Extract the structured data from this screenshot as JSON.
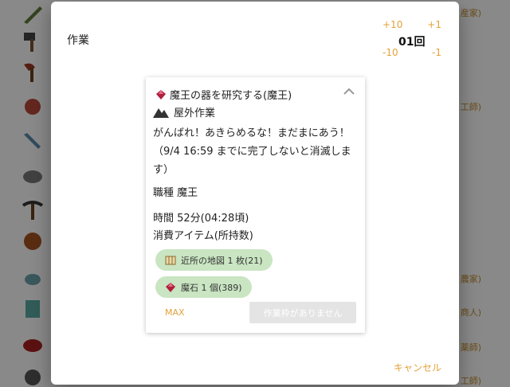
{
  "background": {
    "right_labels": [
      "産家)",
      "工師)",
      "農家)",
      "商人)",
      "薬師)",
      "工師)"
    ]
  },
  "dialog": {
    "title": "作業",
    "counter": {
      "plus10": "+10",
      "plus1": "+1",
      "minus10": "-10",
      "minus1": "-1",
      "value": "01回"
    },
    "task": {
      "title": "魔王の器を研究する(魔王)",
      "location": "屋外作業",
      "description": "がんばれ！あきらめるな！まだまにあう！（9/4 16:59 までに完了しないと消滅します）",
      "job": "職種 魔王",
      "time": "時間 52分(04:28頃)",
      "items_label": "消費アイテム(所持数)",
      "items": [
        {
          "label": "近所の地図 1 枚(21)",
          "icon": "map-icon"
        },
        {
          "label": "魔石 1 個(389)",
          "icon": "gem-icon"
        }
      ],
      "max_label": "MAX",
      "action_label": "作業枠がありません"
    },
    "cancel_label": "キャンセル"
  },
  "colors": {
    "accent": "#e3a23a",
    "chip": "#c9e5c2",
    "gem": "#b0213c"
  }
}
